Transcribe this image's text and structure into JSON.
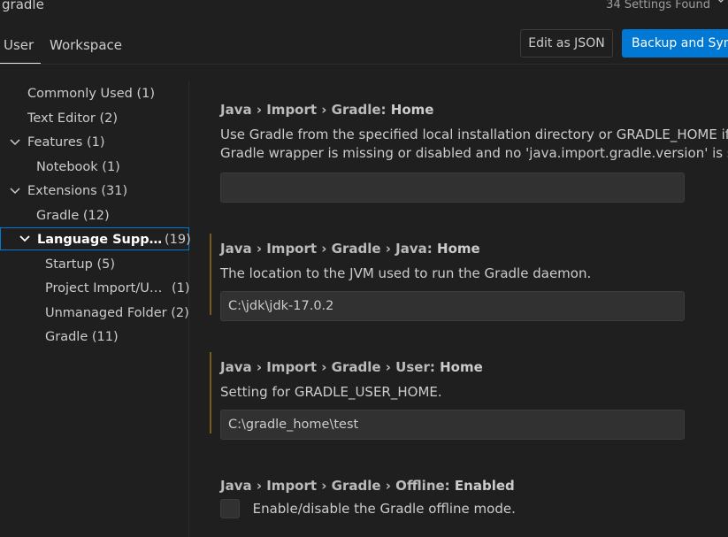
{
  "search": {
    "query": "gradle",
    "results_count": "34 Settings Found"
  },
  "tabs": {
    "user": "User",
    "workspace": "Workspace"
  },
  "header": {
    "edit_json": "Edit as JSON",
    "backup_sync": "Backup and Sync"
  },
  "sidebar": {
    "items": [
      {
        "label": "Commonly Used",
        "count": "(1)"
      },
      {
        "label": "Text Editor",
        "count": "(2)"
      },
      {
        "label": "Features",
        "count": "(1)"
      },
      {
        "label": "Notebook",
        "count": "(1)"
      },
      {
        "label": "Extensions",
        "count": "(31)"
      },
      {
        "label": "Gradle",
        "count": "(12)"
      },
      {
        "label": "Language Supp…",
        "count": "(19)"
      },
      {
        "label": "Startup",
        "count": "(5)"
      },
      {
        "label": "Project Import/U…",
        "count": "(1)"
      },
      {
        "label": "Unmanaged Folder",
        "count": "(2)"
      },
      {
        "label": "Gradle",
        "count": "(11)"
      }
    ]
  },
  "settings": [
    {
      "category": "Java › Import › Gradle: ",
      "name": "Home",
      "description_line1": "Use Gradle from the specified local installation directory or GRADLE_HOME if the",
      "description_line2": "Gradle wrapper is missing or disabled and no 'java.import.gradle.version' is specified.",
      "value": ""
    },
    {
      "category": "Java › Import › Gradle › Java: ",
      "name": "Home",
      "description": "The location to the JVM used to run the Gradle daemon.",
      "value": "C:\\jdk\\jdk-17.0.2"
    },
    {
      "category": "Java › Import › Gradle › User: ",
      "name": "Home",
      "description": "Setting for GRADLE_USER_HOME.",
      "value": "C:\\gradle_home\\test"
    },
    {
      "category": "Java › Import › Gradle › Offline: ",
      "name": "Enabled",
      "checkbox_label": "Enable/disable the Gradle offline mode.",
      "checked": false
    }
  ],
  "colors": {
    "accent": "#0078d4",
    "background": "#1f1f1f",
    "modified_bar": "#7a5a1c"
  }
}
